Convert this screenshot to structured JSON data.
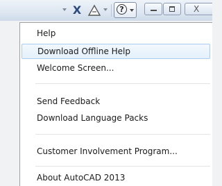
{
  "titlebar": {
    "x_icon_glyph": "X",
    "help_glyph": "?",
    "close_glyph": "X"
  },
  "menu": {
    "items": [
      {
        "label": "Help"
      },
      {
        "label": "Download Offline Help",
        "highlighted": true
      },
      {
        "label": "Welcome Screen..."
      },
      {
        "label": "Send Feedback"
      },
      {
        "label": "Download Language Packs"
      },
      {
        "label": "Customer Involvement Program..."
      },
      {
        "label": "About AutoCAD 2013"
      }
    ]
  },
  "colors": {
    "highlight_border": "#a9cdee",
    "highlight_fill": "#e4f0fb",
    "titlebar_bg": "#dde6f1"
  }
}
